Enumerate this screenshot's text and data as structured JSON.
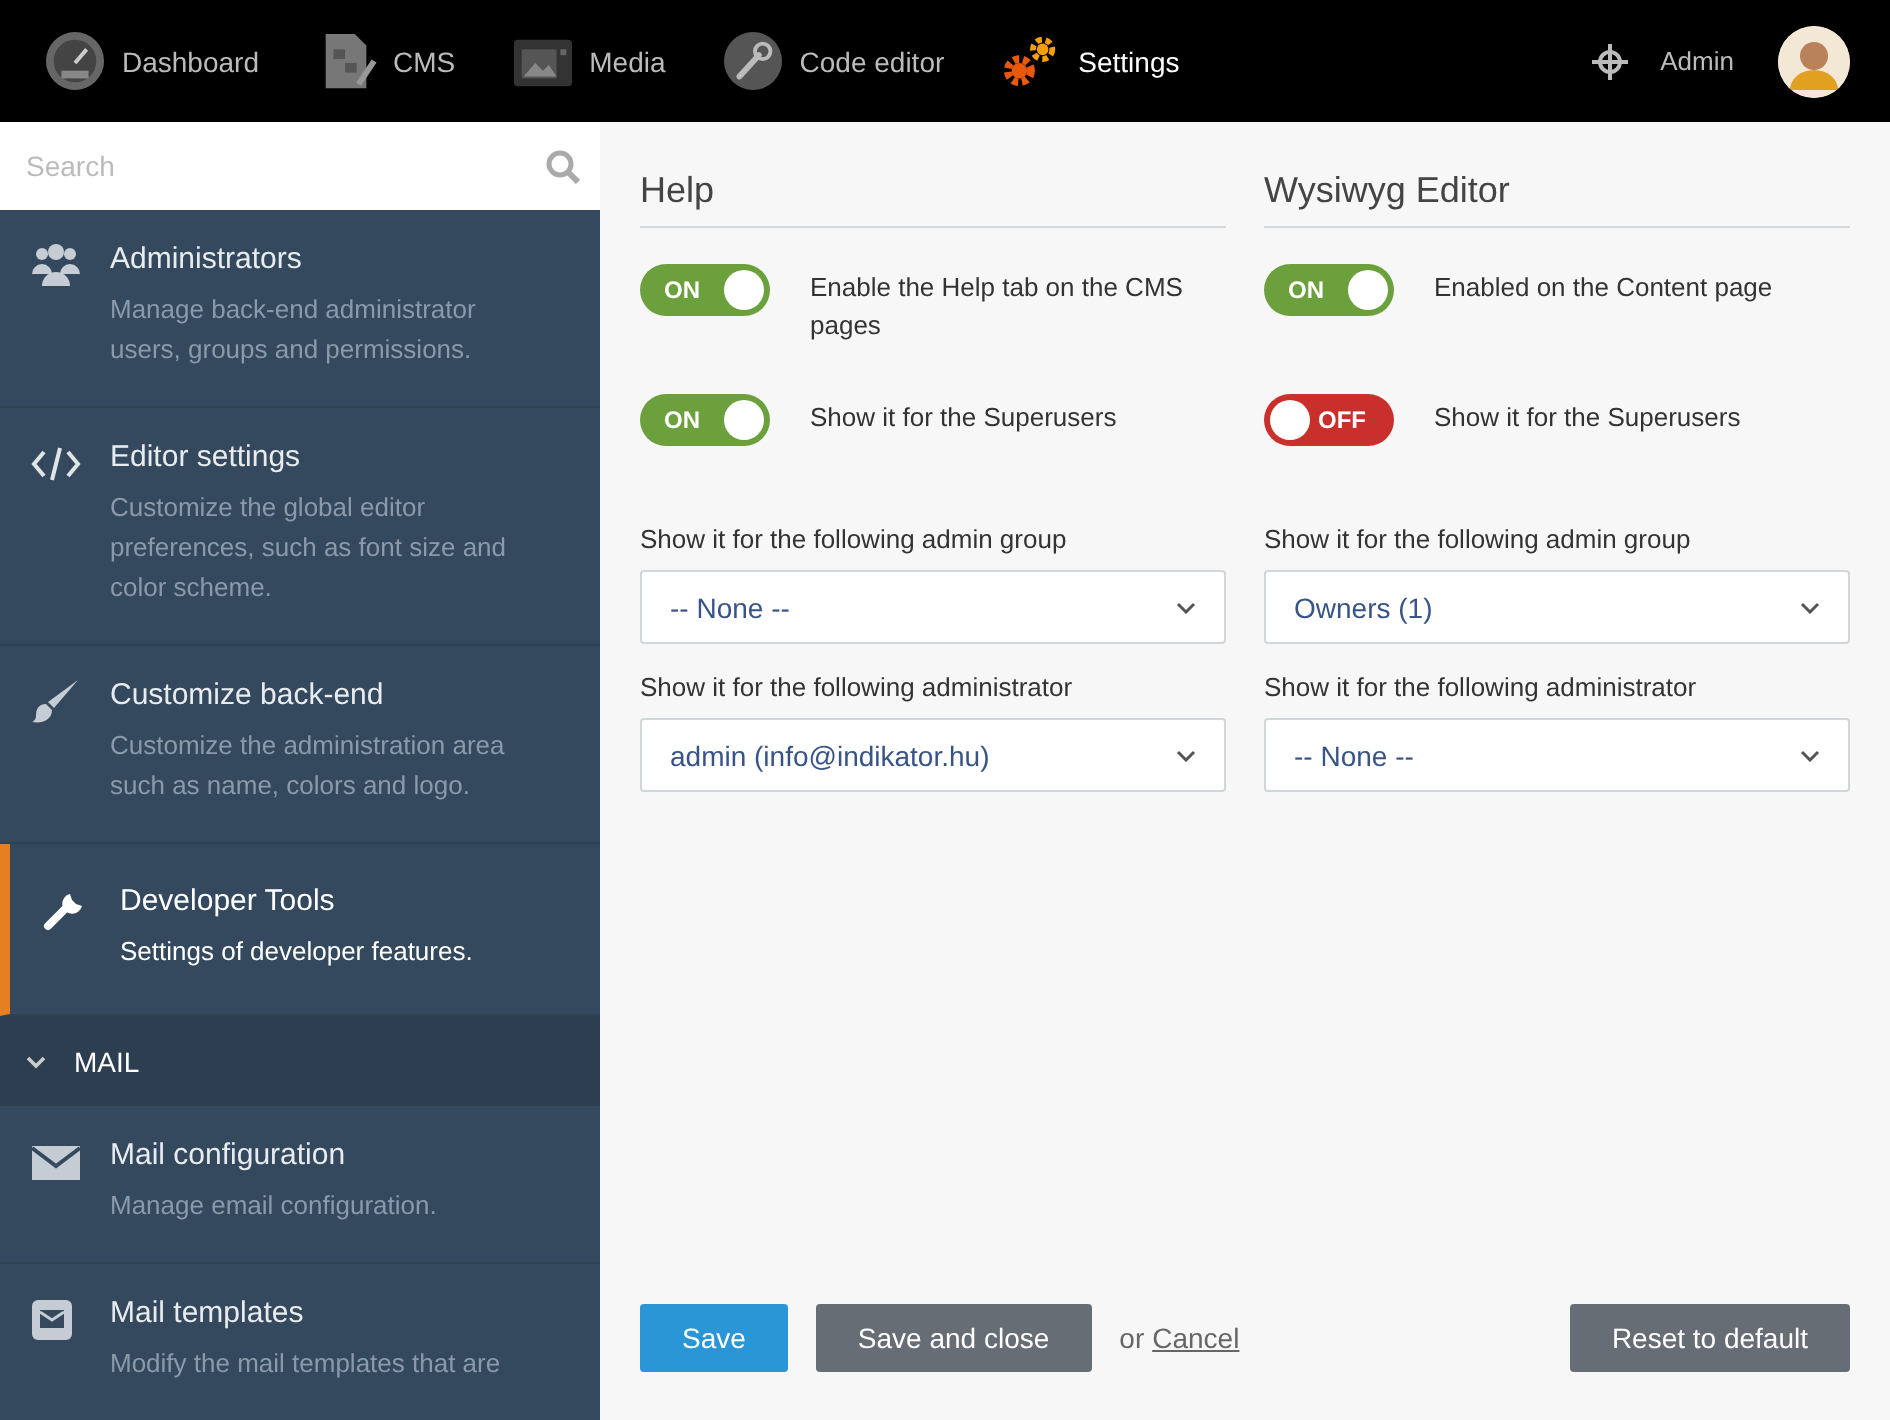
{
  "top_bar": {
    "nav": [
      {
        "label": "Dashboard",
        "selected": false
      },
      {
        "label": "CMS",
        "selected": false
      },
      {
        "label": "Media",
        "selected": false
      },
      {
        "label": "Code editor",
        "selected": false
      },
      {
        "label": "Settings",
        "selected": true
      }
    ],
    "user": {
      "name": "Admin"
    }
  },
  "sidebar": {
    "search": {
      "placeholder": "Search"
    },
    "items": [
      {
        "kind": "item",
        "title": "Administrators",
        "description": "Manage back-end administrator users, groups and permissions.",
        "selected": false
      },
      {
        "kind": "item",
        "title": "Editor settings",
        "description": "Customize the global editor preferences, such as font size and color scheme.",
        "selected": false
      },
      {
        "kind": "item",
        "title": "Customize back-end",
        "description": "Customize the administration area such as name, colors and logo.",
        "selected": false
      },
      {
        "kind": "item",
        "title": "Developer Tools",
        "description": "Settings of developer features.",
        "selected": true
      },
      {
        "kind": "section",
        "title": "MAIL",
        "expanded": true
      },
      {
        "kind": "item",
        "title": "Mail configuration",
        "description": "Manage email configuration.",
        "selected": false
      },
      {
        "kind": "item",
        "title": "Mail templates",
        "description": "Modify the mail templates that are",
        "selected": false
      }
    ]
  },
  "columns": [
    {
      "title": "Help",
      "toggles": [
        {
          "label": "Enable the Help tab on the CMS pages",
          "on": true,
          "switch_text": "ON"
        },
        {
          "label": "Show it for the Superusers",
          "on": true,
          "switch_text": "ON"
        }
      ],
      "selects": [
        {
          "label": "Show it for the following admin group",
          "value": "-- None --"
        },
        {
          "label": "Show it for the following administrator",
          "value": "admin (info@indikator.hu)"
        }
      ]
    },
    {
      "title": "Wysiwyg Editor",
      "toggles": [
        {
          "label": "Enabled on the Content page",
          "on": true,
          "switch_text": "ON"
        },
        {
          "label": "Show it for the Superusers",
          "on": false,
          "switch_text": "OFF"
        }
      ],
      "selects": [
        {
          "label": "Show it for the following admin group",
          "value": "Owners (1)"
        },
        {
          "label": "Show it for the following administrator",
          "value": "-- None --"
        }
      ]
    }
  ],
  "footer": {
    "save": "Save",
    "save_close": "Save and close",
    "or": "or",
    "cancel": "Cancel",
    "reset": "Reset to default"
  }
}
